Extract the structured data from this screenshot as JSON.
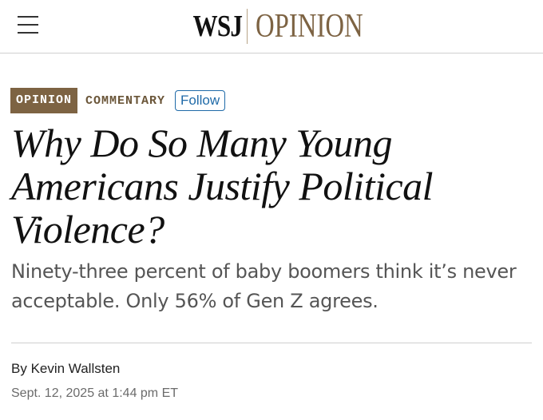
{
  "header": {
    "logo_wsj": "WSJ",
    "logo_section": "OPINION"
  },
  "tags": {
    "section": "OPINION",
    "category": "COMMENTARY",
    "follow_label": "Follow"
  },
  "article": {
    "headline": "Why Do So Many Young Americans Justify Political Violence?",
    "dek": "Ninety-three percent of baby boomers think it’s never acceptable. Only 56% of Gen Z agrees.",
    "byline_prefix": "By ",
    "author": "Kevin Wallsten",
    "date": "Sept. 12, 2025 at 1:44 pm ET"
  },
  "colors": {
    "brand_opinion": "#7d6343",
    "follow_accent": "#1f6aa8"
  },
  "icons": {
    "menu": "hamburger-menu-icon"
  }
}
